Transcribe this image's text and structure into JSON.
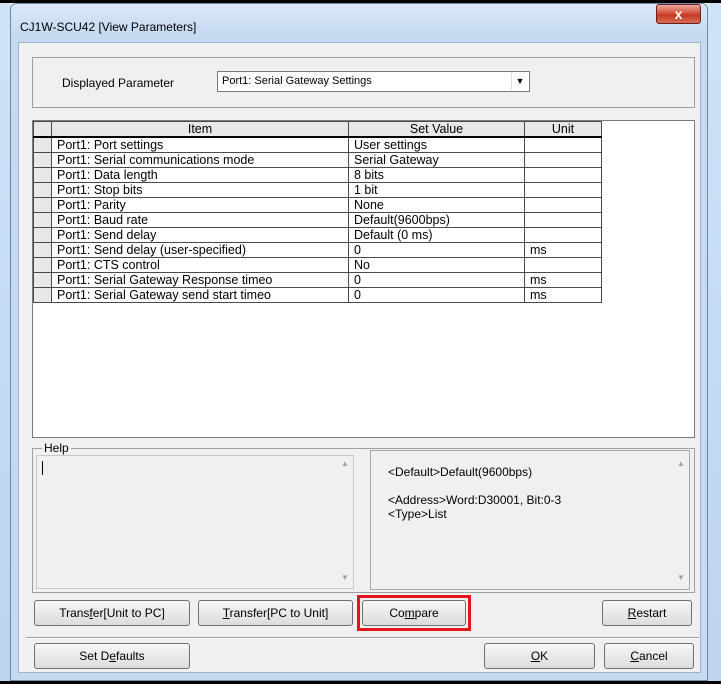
{
  "window": {
    "title": "CJ1W-SCU42 [View Parameters]",
    "close_glyph": "x"
  },
  "param_select": {
    "label": "Displayed Parameter",
    "value": "Port1: Serial Gateway Settings",
    "arrow_icon": "▼"
  },
  "table": {
    "headers": [
      "Item",
      "Set Value",
      "Unit"
    ],
    "rows": [
      {
        "item": "Port1: Port settings",
        "value": "User settings",
        "unit": ""
      },
      {
        "item": "Port1: Serial communications mode",
        "value": "Serial Gateway",
        "unit": ""
      },
      {
        "item": "Port1: Data length",
        "value": "8 bits",
        "unit": ""
      },
      {
        "item": "Port1: Stop bits",
        "value": "1 bit",
        "unit": ""
      },
      {
        "item": "Port1: Parity",
        "value": "None",
        "unit": ""
      },
      {
        "item": "Port1: Baud rate",
        "value": "Default(9600bps)",
        "unit": ""
      },
      {
        "item": "Port1: Send delay",
        "value": "Default (0 ms)",
        "unit": ""
      },
      {
        "item": "Port1: Send delay (user-specified)",
        "value": "0",
        "unit": "ms"
      },
      {
        "item": "Port1: CTS control",
        "value": "No",
        "unit": ""
      },
      {
        "item": "Port1: Serial Gateway Response timeo",
        "value": "0",
        "unit": "ms"
      },
      {
        "item": "Port1: Serial Gateway send start timeo",
        "value": "0",
        "unit": "ms"
      }
    ]
  },
  "help": {
    "label": "Help",
    "line1": "<Default>Default(9600bps)",
    "line2": "<Address>Word:D30001, Bit:0-3",
    "line3": "<Type>List",
    "scroll_up_icon": "▲",
    "scroll_down_icon": "▼"
  },
  "buttons": {
    "transfer_unit_to_pc": {
      "pre": "Trans",
      "key": "f",
      "post": "er[Unit to PC]"
    },
    "transfer_pc_to_unit": {
      "pre": "",
      "key": "T",
      "post": "ransfer[PC to Unit]"
    },
    "compare": {
      "pre": "Co",
      "key": "m",
      "post": "pare"
    },
    "restart": {
      "pre": "",
      "key": "R",
      "post": "estart"
    },
    "set_defaults": {
      "pre": "Set D",
      "key": "e",
      "post": "faults"
    },
    "ok": {
      "pre": "",
      "key": "O",
      "post": "K"
    },
    "cancel": {
      "pre": "",
      "key": "C",
      "post": "ancel"
    }
  },
  "colors": {
    "highlight": "#e3141b",
    "close_button": "#c23b22"
  }
}
